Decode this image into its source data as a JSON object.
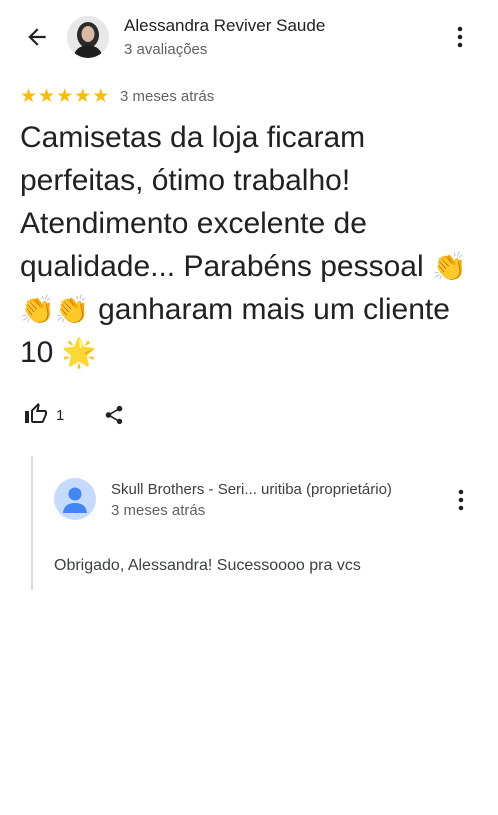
{
  "header": {
    "reviewer_name": "Alessandra Reviver Saude",
    "review_count": "3 avaliações",
    "back_icon": "arrow-left-icon",
    "more_icon": "more-vert-icon"
  },
  "review": {
    "rating": 5,
    "rating_max": 5,
    "star_color": "#fbbc04",
    "date": "3 meses atrás",
    "text_parts": {
      "p1": "Camisetas da loja ficaram perfeitas, ótimo trabalho! Atendimento excelente de qualidade... Parabéns pessoal ",
      "emoji_clap": "👏👏👏",
      "p2": " ganharam mais um cliente 10 ",
      "emoji_star": "🌟"
    },
    "like_count": "1"
  },
  "reply": {
    "owner_name": "Skull Brothers - Seri... uritiba (proprietário)",
    "date": "3 meses atrás",
    "text": "Obrigado, Alessandra! Sucessoooo pra vcs"
  }
}
